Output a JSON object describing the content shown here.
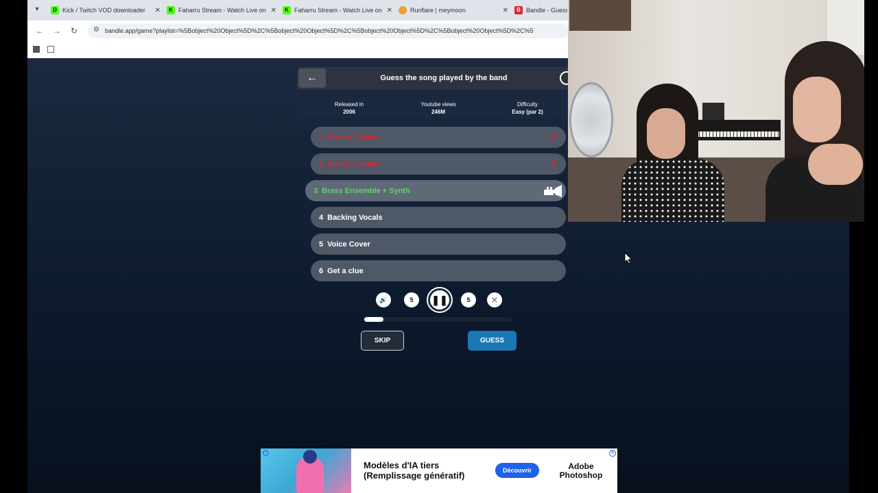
{
  "browser": {
    "tabs": [
      {
        "title": "Kick / Twitch VOD downloader",
        "favicon": "D",
        "favicon_color": "#53fc18"
      },
      {
        "title": "Faharru Stream - Watch Live on",
        "favicon": "K",
        "favicon_color": "#53fc18"
      },
      {
        "title": "Faharru Stream - Watch Live on",
        "favicon": "K",
        "favicon_color": "#53fc18"
      },
      {
        "title": "Runflare | meymoon",
        "favicon": "",
        "favicon_color": "#f0a030"
      },
      {
        "title": "Bandle - Guess",
        "favicon": "B",
        "favicon_color": "#e0232f"
      }
    ],
    "url": "bandle.app/game?playlist=%5Bobject%20Object%5D%2C%5Bobject%20Object%5D%2C%5Bobject%20Object%5D%2C%5Bobject%20Object%5D%2C%5"
  },
  "game": {
    "back_icon": "arrow-left-icon",
    "title": "Guess the song played by the band",
    "info": [
      {
        "label": "Released in",
        "value": "2006"
      },
      {
        "label": "Youtube views",
        "value": "246M"
      },
      {
        "label": "Difficulty",
        "value": "Easy (par 2)"
      }
    ],
    "steps": [
      {
        "num": "1",
        "label": "Drums + Bass",
        "state": "failed"
      },
      {
        "num": "2",
        "label": "Electric Guitar",
        "state": "failed"
      },
      {
        "num": "3",
        "label": "Brass Ensemble + Synth",
        "state": "current"
      },
      {
        "num": "4",
        "label": "Backing Vocals",
        "state": "locked"
      },
      {
        "num": "5",
        "label": "Voice Cover",
        "state": "locked"
      },
      {
        "num": "6",
        "label": "Get a clue",
        "state": "locked"
      }
    ],
    "controls": {
      "rewind_label": "5",
      "forward_label": "5",
      "progress": 0.13
    },
    "skip_label": "SKIP",
    "guess_label": "GUESS"
  },
  "ad": {
    "line1": "Modèles d'IA tiers",
    "line2": "(Remplissage génératif)",
    "cta": "Découvrir",
    "brand1": "Adobe",
    "brand2": "Photoshop"
  },
  "colors": {
    "failed": "#e0232f",
    "current": "#5fd46a",
    "guess_button": "#1a78b5"
  }
}
